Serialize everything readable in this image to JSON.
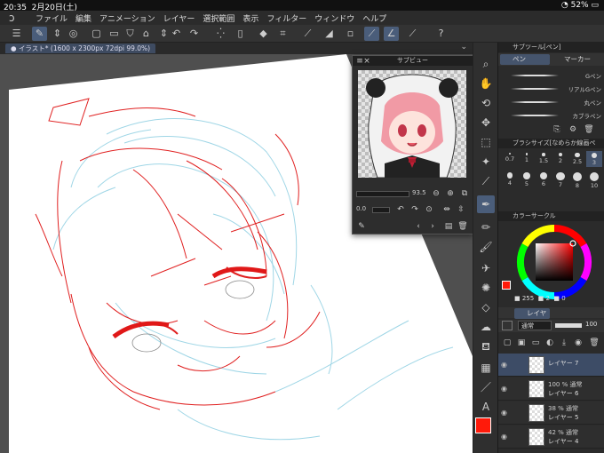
{
  "status": {
    "time": "20:35",
    "date": "2月20日(土)",
    "battery": "52%"
  },
  "menu": [
    "ファイル",
    "編集",
    "アニメーション",
    "レイヤー",
    "選択範囲",
    "表示",
    "フィルター",
    "ウィンドウ",
    "ヘルプ"
  ],
  "tab": {
    "label": "イラスト* (1600 x 2300px 72dpi 99.0%)"
  },
  "subview": {
    "title": "サブビュー",
    "zoom": "93.5",
    "rotation": "0.0"
  },
  "subtool": {
    "header": "サブツール[ペン]",
    "tabs": [
      "ペン",
      "マーカー"
    ],
    "pens": [
      "Gペン",
      "リアルGペン",
      "丸ペン",
      "カブラペン"
    ]
  },
  "brushsize": {
    "header": "ブラシサイズ[なめらか線画ペ",
    "sizes": [
      "0.7",
      "1",
      "1.5",
      "2",
      "2.5",
      "3",
      "4",
      "5",
      "6",
      "7",
      "8",
      "10"
    ]
  },
  "color": {
    "header": "カラーサークル",
    "r": "255",
    "g": "2",
    "b": "0",
    "main": "#ff1a0a"
  },
  "layers": {
    "tab": "レイヤー",
    "blend": "通常",
    "opacity": "100",
    "rows": [
      {
        "name": "レイヤー 7",
        "info": "",
        "selected": true
      },
      {
        "name": "レイヤー 6",
        "info": "100 % 通常"
      },
      {
        "name": "レイヤー 5",
        "info": "38 % 通常"
      },
      {
        "name": "レイヤー 4",
        "info": "42 % 通常"
      }
    ]
  }
}
